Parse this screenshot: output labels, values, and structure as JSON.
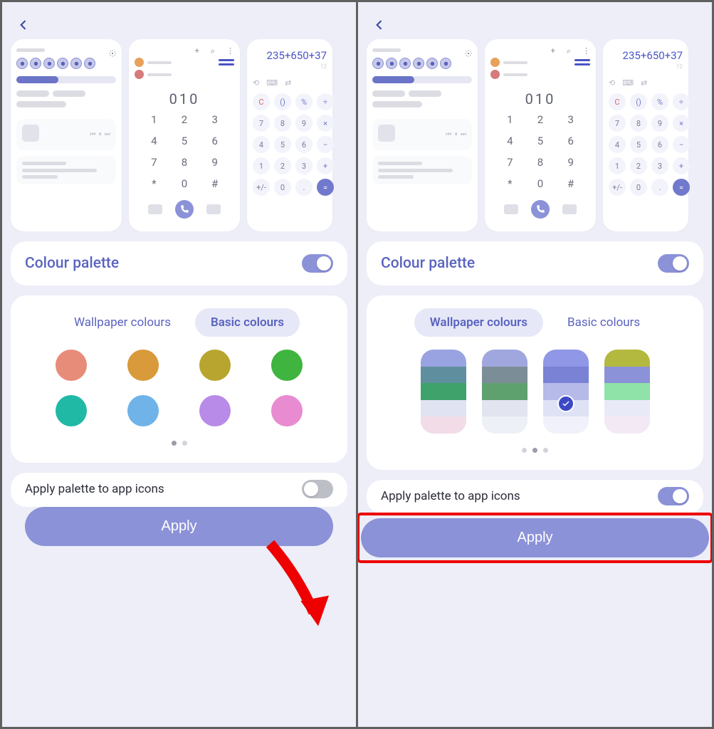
{
  "header": {
    "back_icon": "back-chevron"
  },
  "preview": {
    "notif": {
      "gear_icon": "gear",
      "qs_icons": [
        "wifi",
        "bluetooth",
        "sound",
        "rotate",
        "airplane",
        "torch"
      ]
    },
    "dialer": {
      "top_icons": [
        "add",
        "search",
        "more"
      ],
      "display": "010",
      "keys": [
        "1",
        "2",
        "3",
        "4",
        "5",
        "6",
        "7",
        "8",
        "9",
        "*",
        "0",
        "#"
      ]
    },
    "calc": {
      "expr": "235+650+37",
      "keys": [
        {
          "l": "C",
          "cls": "c-clear"
        },
        {
          "l": "()",
          "cls": "c-op"
        },
        {
          "l": "%",
          "cls": "c-op"
        },
        {
          "l": "÷",
          "cls": "c-op"
        },
        {
          "l": "7"
        },
        {
          "l": "8"
        },
        {
          "l": "9"
        },
        {
          "l": "×",
          "cls": "c-op"
        },
        {
          "l": "4"
        },
        {
          "l": "5"
        },
        {
          "l": "6"
        },
        {
          "l": "−",
          "cls": "c-op"
        },
        {
          "l": "1"
        },
        {
          "l": "2"
        },
        {
          "l": "3"
        },
        {
          "l": "+",
          "cls": "c-op"
        },
        {
          "l": "+/-"
        },
        {
          "l": "0"
        },
        {
          "l": "."
        },
        {
          "l": "=",
          "cls": "c-eq"
        }
      ]
    }
  },
  "palette": {
    "title": "Colour palette",
    "toggle_on": true,
    "tabs": {
      "wallpaper": "Wallpaper colours",
      "basic": "Basic colours"
    },
    "basic_colors": [
      "#e88c7a",
      "#d89a3b",
      "#b8a52f",
      "#3fb43f",
      "#1fb9a6",
      "#6fb3e8",
      "#b98be8",
      "#e88bd1"
    ],
    "wallpaper_colors": [
      [
        "#9aa3e2",
        "#5f8f9e",
        "#3fa26b",
        "#e0e3f2",
        "#f2dce8"
      ],
      [
        "#a0a7de",
        "#7b8d96",
        "#5fa06f",
        "#e2e4ef",
        "#eef0f7"
      ],
      [
        "#8f97e6",
        "#7a82d6",
        "#b6bae8",
        "#dfe2f5",
        "#f0f1fa"
      ],
      [
        "#b3b93f",
        "#8b92d8",
        "#8fe2a8",
        "#e8eaf7",
        "#f3e9f5"
      ]
    ],
    "selected_wallpaper_index": 2
  },
  "apply_icons": {
    "label": "Apply palette to app icons"
  },
  "apply_button": "Apply",
  "left": {
    "active_tab": "basic",
    "apply_icons_on": false,
    "pager": {
      "count": 2,
      "active": 0
    }
  },
  "right": {
    "active_tab": "wallpaper",
    "apply_icons_on": true,
    "pager": {
      "count": 3,
      "active": 1
    }
  }
}
